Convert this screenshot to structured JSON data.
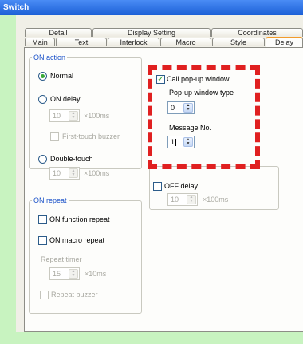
{
  "window": {
    "title": "Switch"
  },
  "tabs_back": [
    "Detail",
    "Display Setting",
    "Coordinates"
  ],
  "tabs_front": [
    "Main",
    "Text",
    "Interlock",
    "Macro",
    "Style",
    "Delay"
  ],
  "on_action": {
    "legend": "ON action",
    "normal": "Normal",
    "on_delay": "ON delay",
    "on_delay_value": "10",
    "unit_100ms": "×100ms",
    "first_touch_buzzer": "First-touch buzzer",
    "double_touch": "Double-touch",
    "double_touch_value": "10"
  },
  "popup": {
    "call_popup": "Call pop-up window",
    "type_label": "Pop-up window type",
    "type_value": "0",
    "message_label": "Message No.",
    "message_value": "1"
  },
  "off_delay": {
    "label": "OFF delay",
    "value": "10",
    "unit": "×100ms"
  },
  "on_repeat": {
    "legend": "ON repeat",
    "function_repeat": "ON function repeat",
    "macro_repeat": "ON macro repeat",
    "repeat_timer": "Repeat timer",
    "timer_value": "15",
    "unit": "×10ms",
    "repeat_buzzer": "Repeat buzzer"
  },
  "colors": {
    "accent": "#1b52c9",
    "highlight": "#e02020",
    "active_tab": "#f29b2b"
  },
  "icons": {
    "spin": "spin-arrows-icon",
    "check": "checkmark-icon"
  }
}
